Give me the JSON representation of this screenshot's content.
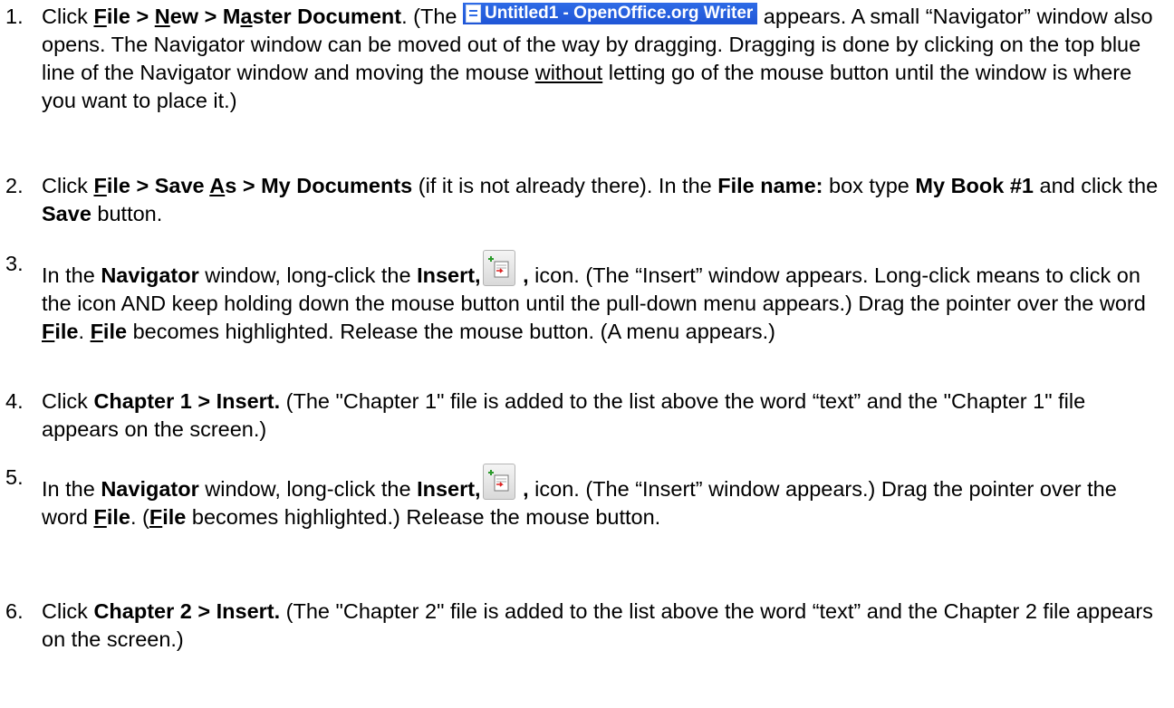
{
  "steps": [
    {
      "num": "1.",
      "a1": "Click ",
      "file_f": "F",
      "file_rest": "ile",
      "sep1": " > ",
      "new_n": "N",
      "new_rest": "ew",
      "sep2": "  > M",
      "master_a": "a",
      "master_rest": "ster Document",
      "a2": ". (The ",
      "window_title": "Untitled1 - OpenOffice.org Writer",
      "a3": " appears. A small  “Navigator” window also opens. The Navigator window can be moved out of the way by dragging.   Dragging is done by clicking on the top blue line of the Navigator window and moving the mouse ",
      "without": "without",
      "a4": " letting go of the mouse button until the window is where you want to place it.)"
    },
    {
      "num": "2.",
      "a1": "Click ",
      "file_f": "F",
      "file_rest": "ile > Save ",
      "as_a": "A",
      "as_rest": "s > My Documents",
      "a2": " (if it is not already there).  In the ",
      "filename": "File name:",
      "a3": " box type ",
      "mybook": "My Book #1",
      "a4": " and click the ",
      "save": "Save",
      "a5": " button."
    },
    {
      "num": "3.",
      "a1": "In the ",
      "navigator": "Navigator",
      "a2": " window, long-click the ",
      "insert": "Insert,",
      "comma": " ,",
      "a3": " icon.   (The “Insert” window appears.  Long-click means to click on the icon AND keep holding down the mouse button until the pull-down menu appears.)  Drag the pointer over the word ",
      "file1_f": "F",
      "file1_rest": "ile",
      "a4": ".  ",
      "file2_f": "F",
      "file2_rest": "ile",
      "a5": " becomes highlighted.  Release the mouse button.  (A menu appears.)"
    },
    {
      "num": "4.",
      "a1": "Click ",
      "cmd": "Chapter 1 > Insert.",
      "a2": "  (The \"Chapter 1\" file is added to the list above the word “text” and  the \"Chapter 1\" file appears on the screen.)"
    },
    {
      "num": "5.",
      "a1": "In the ",
      "navigator": "Navigator",
      "a2": " window, long-click the ",
      "insert": "Insert,",
      "comma": " ,",
      "a3": " icon. (The “Insert” window appears.)  Drag the pointer over the word ",
      "file1_f": "F",
      "file1_rest": "ile",
      "a4": ".  (",
      "file2_f": "F",
      "file2_rest": "ile",
      "a5": " becomes highlighted.)  Release the  mouse button."
    },
    {
      "num": "6.",
      "a1": "Click ",
      "cmd": "Chapter 2 > Insert.",
      "a2": "  (The \"Chapter 2\" file is added to the list above the word “text” and the Chapter 2 file appears on the screen.)"
    }
  ]
}
